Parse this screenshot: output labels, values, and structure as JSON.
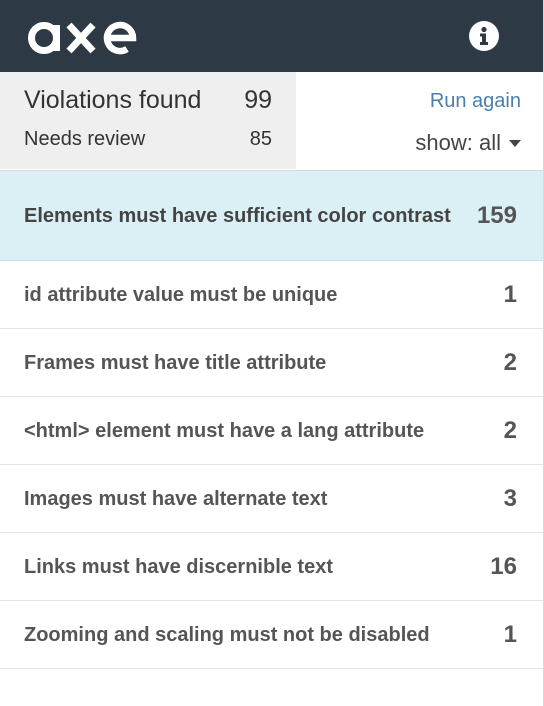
{
  "header": {
    "logo_text": "axe",
    "info_icon": "info-icon"
  },
  "summary": {
    "violations_label": "Violations found",
    "violations_count": "99",
    "review_label": "Needs review",
    "review_count": "85",
    "run_again_label": "Run again",
    "show_label": "show: all"
  },
  "issues": [
    {
      "title": "Elements must have sufficient color contrast",
      "count": "159"
    },
    {
      "title": "id attribute value must be unique",
      "count": "1"
    },
    {
      "title": "Frames must have title attribute",
      "count": "2"
    },
    {
      "title": "<html> element must have a lang attribute",
      "count": "2"
    },
    {
      "title": "Images must have alternate text",
      "count": "3"
    },
    {
      "title": "Links must have discernible text",
      "count": "16"
    },
    {
      "title": "Zooming and scaling must not be disabled",
      "count": "1"
    }
  ],
  "colors": {
    "header_bg": "#2e3946",
    "selected_row_bg": "#daf0f5",
    "link": "#4a7fad"
  }
}
